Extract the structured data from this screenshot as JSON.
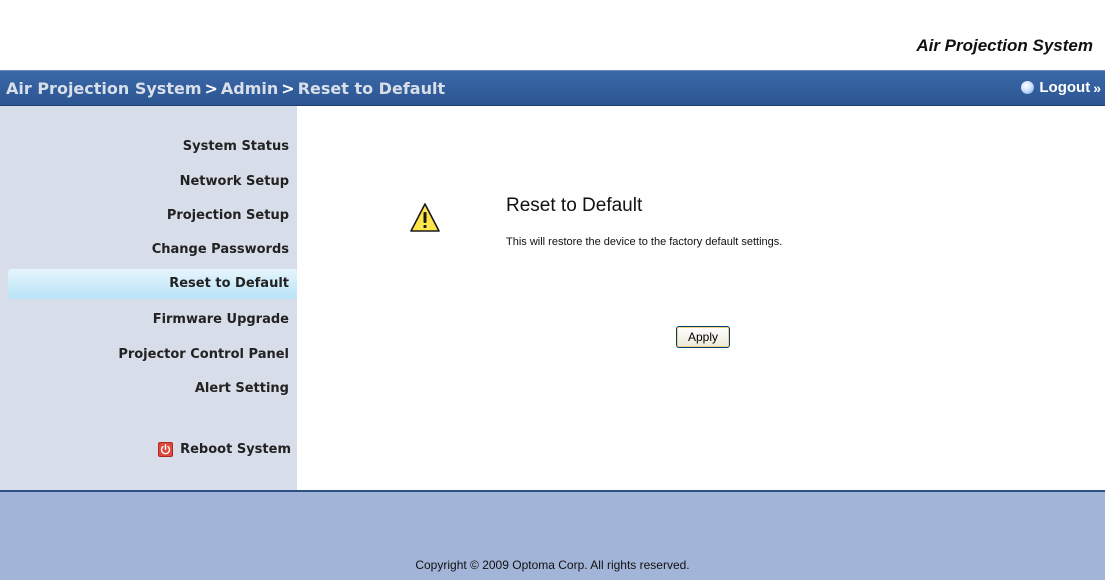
{
  "brand": {
    "title": "Air Projection System"
  },
  "breadcrumb": {
    "items": [
      "Air Projection System",
      "Admin",
      "Reset to Default"
    ],
    "separator": ">"
  },
  "logout": {
    "label": "Logout",
    "arrow": "»"
  },
  "sidebar": {
    "items": [
      {
        "label": "System Status",
        "active": false
      },
      {
        "label": "Network Setup",
        "active": false
      },
      {
        "label": "Projection Setup",
        "active": false
      },
      {
        "label": "Change Passwords",
        "active": false
      },
      {
        "label": "Reset to Default",
        "active": true
      },
      {
        "label": "Firmware Upgrade",
        "active": false
      },
      {
        "label": "Projector Control Panel",
        "active": false
      },
      {
        "label": "Alert Setting",
        "active": false
      }
    ],
    "reboot_label": "Reboot System",
    "reboot_icon": "power-icon"
  },
  "main": {
    "icon": "warning-icon",
    "title": "Reset to Default",
    "description": "This will restore the device to the factory default settings.",
    "apply_label": "Apply"
  },
  "footer": {
    "copyright": "Copyright © 2009 Optoma Corp. All rights reserved."
  },
  "colors": {
    "header_blue": "#2c5592",
    "sidebar_bg": "#d7dde9",
    "active_item": "#b8e3f7",
    "footer_bg": "#a2b5d8",
    "warning_yellow": "#ffe44a"
  }
}
